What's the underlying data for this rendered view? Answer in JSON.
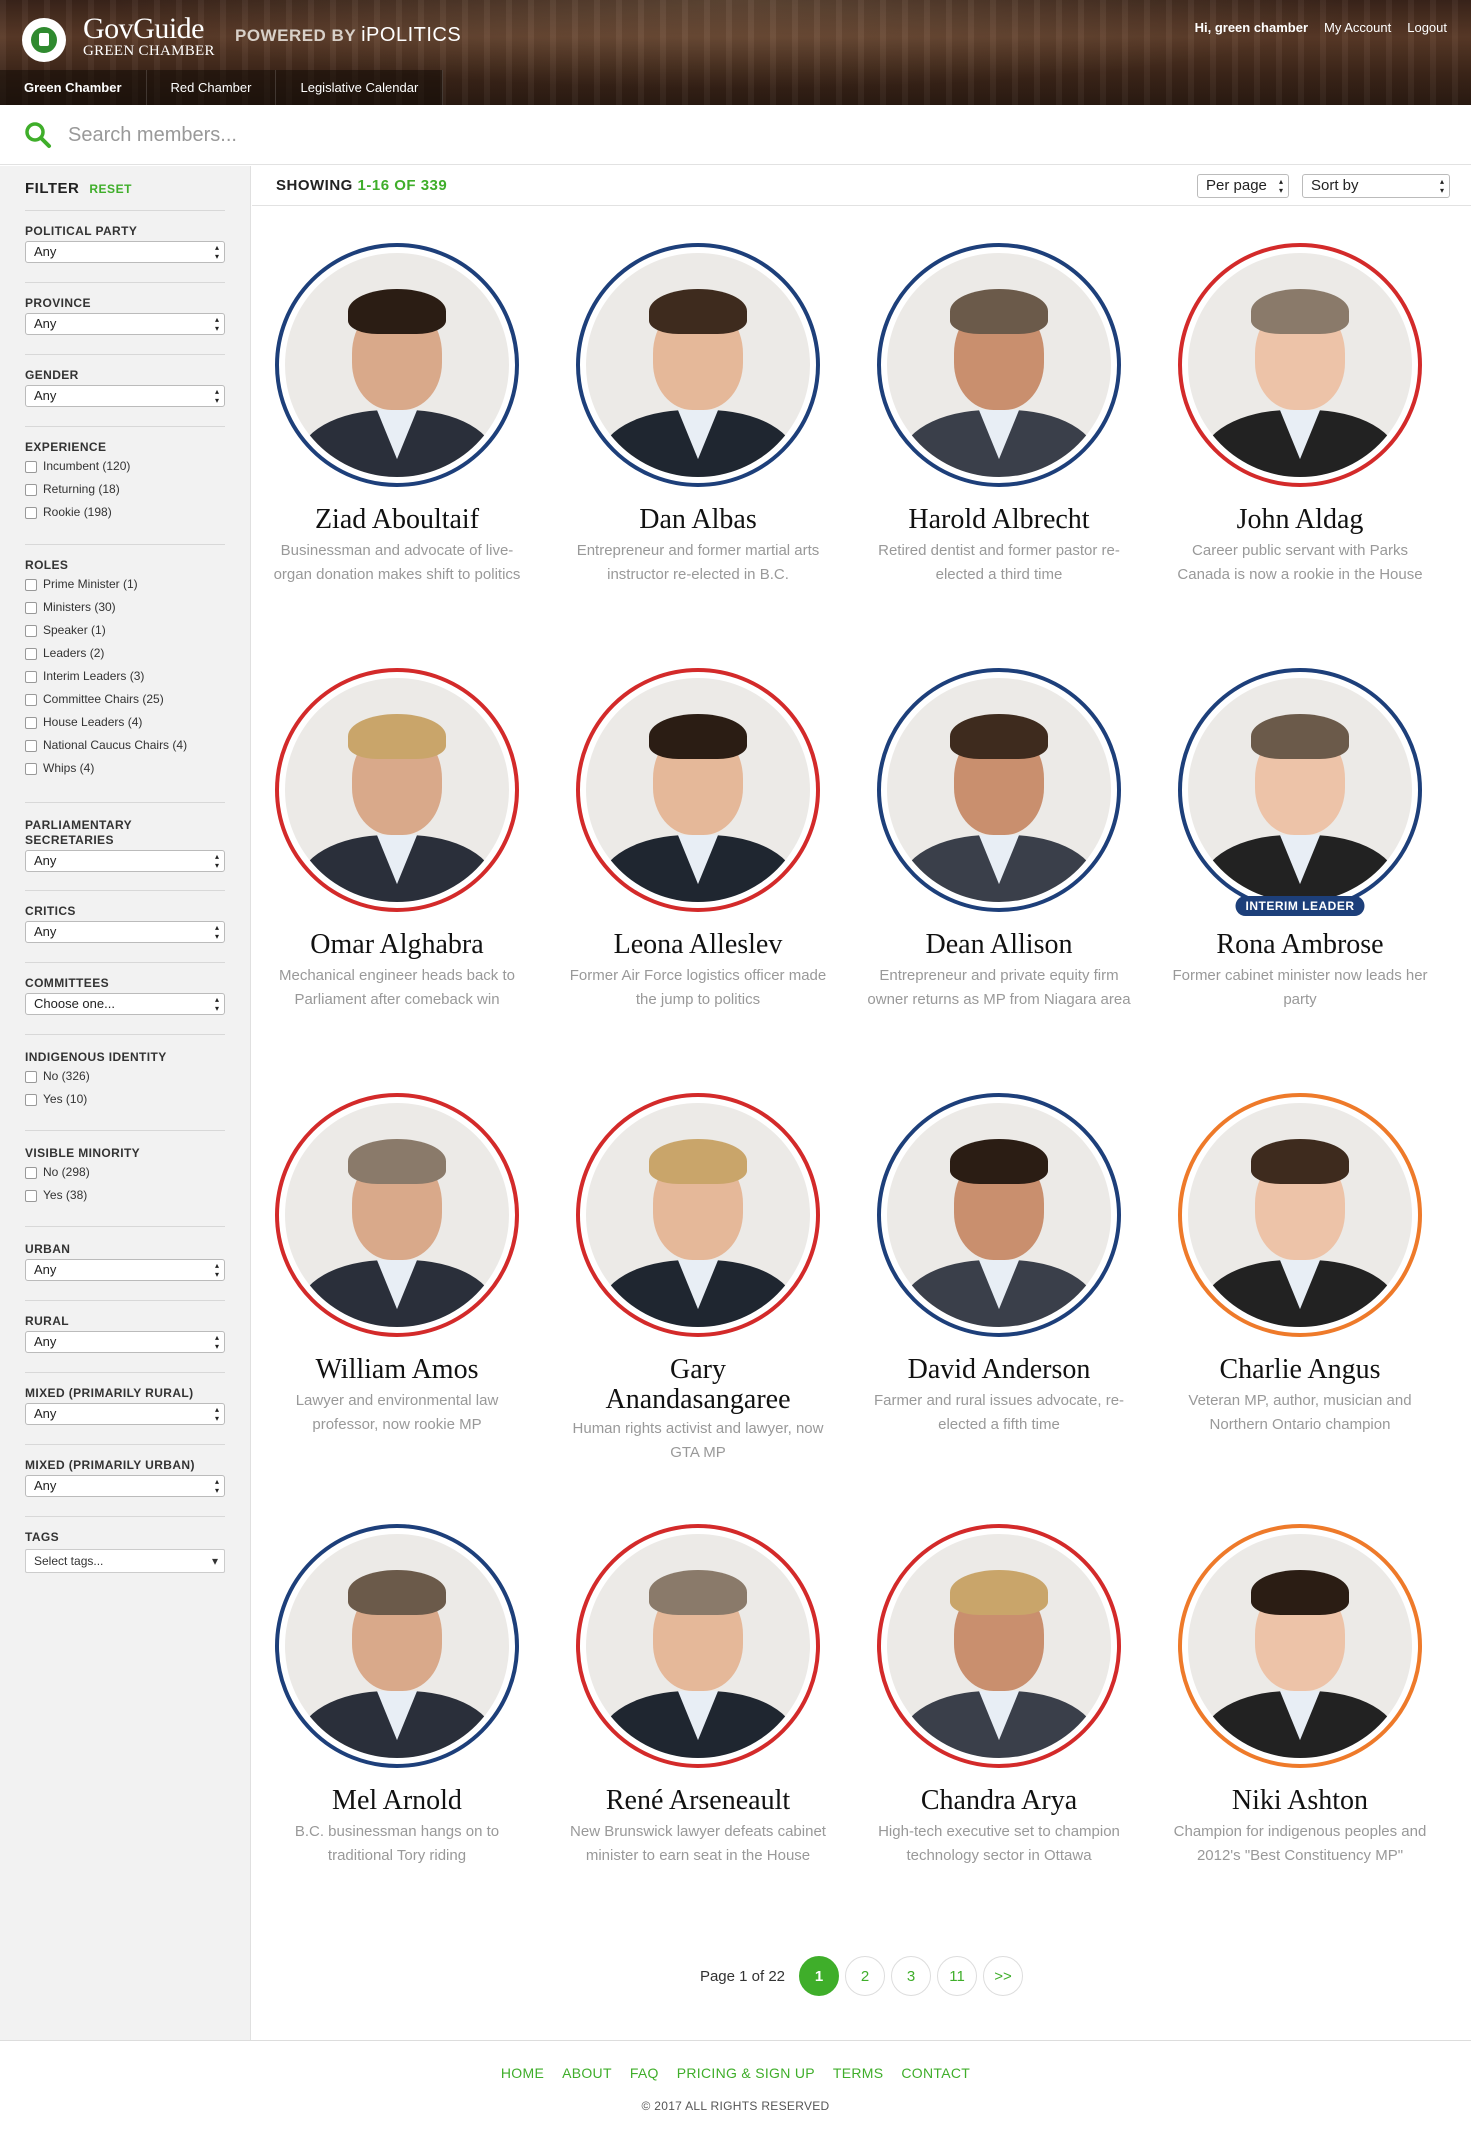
{
  "header": {
    "brand_name": "GovGuide",
    "brand_sub": "GREEN CHAMBER",
    "powered_by": "POWERED BY",
    "powered_brand": "iPOLITICS",
    "greeting": "Hi, green chamber",
    "my_account": "My Account",
    "logout": "Logout",
    "tabs": [
      "Green Chamber",
      "Red Chamber",
      "Legislative Calendar"
    ]
  },
  "search": {
    "placeholder": "Search members..."
  },
  "filter": {
    "title": "FILTER",
    "reset": "RESET",
    "political_party": {
      "title": "POLITICAL PARTY",
      "value": "Any"
    },
    "province": {
      "title": "PROVINCE",
      "value": "Any"
    },
    "gender": {
      "title": "GENDER",
      "value": "Any"
    },
    "experience": {
      "title": "EXPERIENCE",
      "options": [
        "Incumbent (120)",
        "Returning (18)",
        "Rookie (198)"
      ]
    },
    "roles": {
      "title": "ROLES",
      "options": [
        "Prime Minister (1)",
        "Ministers (30)",
        "Speaker (1)",
        "Leaders (2)",
        "Interim Leaders (3)",
        "Committee Chairs (25)",
        "House Leaders (4)",
        "National Caucus Chairs (4)",
        "Whips (4)"
      ]
    },
    "parliamentary_secretaries": {
      "title_line1": "PARLIAMENTARY",
      "title_line2": "SECRETARIES",
      "value": "Any"
    },
    "critics": {
      "title": "CRITICS",
      "value": "Any"
    },
    "committees": {
      "title": "COMMITTEES",
      "value": "Choose one..."
    },
    "indigenous": {
      "title": "INDIGENOUS IDENTITY",
      "options": [
        "No (326)",
        "Yes (10)"
      ]
    },
    "visible_minority": {
      "title": "VISIBLE MINORITY",
      "options": [
        "No (298)",
        "Yes (38)"
      ]
    },
    "urban": {
      "title": "URBAN",
      "value": "Any"
    },
    "rural": {
      "title": "RURAL",
      "value": "Any"
    },
    "mixed_rural": {
      "title": "MIXED (PRIMARILY RURAL)",
      "value": "Any"
    },
    "mixed_urban": {
      "title": "MIXED (PRIMARILY URBAN)",
      "value": "Any"
    },
    "tags": {
      "title": "TAGS",
      "placeholder": "Select tags..."
    }
  },
  "results": {
    "showing_label": "SHOWING",
    "range": "1-16 OF 339",
    "per_page": "Per page",
    "sort_by": "Sort by"
  },
  "members": [
    {
      "name": "Ziad Aboultaif",
      "desc": "Businessman and advocate of live-organ donation makes shift to politics",
      "party_color": "blue"
    },
    {
      "name": "Dan Albas",
      "desc": "Entrepreneur and former martial arts instructor re-elected in B.C.",
      "party_color": "blue"
    },
    {
      "name": "Harold Albrecht",
      "desc": "Retired dentist and former pastor re-elected a third time",
      "party_color": "blue"
    },
    {
      "name": "John Aldag",
      "desc": "Career public servant with Parks Canada is now a rookie in the House",
      "party_color": "red"
    },
    {
      "name": "Omar Alghabra",
      "desc": "Mechanical engineer heads back to Parliament after comeback win",
      "party_color": "red"
    },
    {
      "name": "Leona Alleslev",
      "desc": "Former Air Force logistics officer made the jump to politics",
      "party_color": "red"
    },
    {
      "name": "Dean Allison",
      "desc": "Entrepreneur and private equity firm owner returns as MP from Niagara area",
      "party_color": "blue"
    },
    {
      "name": "Rona Ambrose",
      "desc": "Former cabinet minister now leads her party",
      "party_color": "blue",
      "badge": "INTERIM LEADER"
    },
    {
      "name": "William Amos",
      "desc": "Lawyer and environmental law professor, now rookie MP",
      "party_color": "red"
    },
    {
      "name": "Gary Anandasangaree",
      "desc": "Human rights activist and lawyer, now GTA MP",
      "party_color": "red"
    },
    {
      "name": "David Anderson",
      "desc": "Farmer and rural issues advocate, re-elected a fifth time",
      "party_color": "blue"
    },
    {
      "name": "Charlie Angus",
      "desc": "Veteran MP, author, musician and Northern Ontario champion",
      "party_color": "orange"
    },
    {
      "name": "Mel Arnold",
      "desc": "B.C. businessman hangs on to traditional Tory riding",
      "party_color": "blue"
    },
    {
      "name": "René Arseneault",
      "desc": "New Brunswick lawyer defeats cabinet minister to earn seat in the House",
      "party_color": "red"
    },
    {
      "name": "Chandra Arya",
      "desc": "High-tech executive set to champion technology sector in Ottawa",
      "party_color": "red"
    },
    {
      "name": "Niki Ashton",
      "desc": "Champion for indigenous peoples and 2012's \"Best Constituency MP\"",
      "party_color": "orange"
    }
  ],
  "pagination": {
    "label": "Page 1 of 22",
    "pages": [
      "1",
      "2",
      "3",
      "11",
      ">>"
    ]
  },
  "footer": {
    "links": [
      "HOME",
      "ABOUT",
      "FAQ",
      "PRICING & SIGN UP",
      "TERMS",
      "CONTACT"
    ],
    "copyright": "© 2017 ALL RIGHTS RESERVED"
  },
  "colors": {
    "accent": "#3fae2a",
    "conservative": "#1d3f7a",
    "liberal": "#d32a2a",
    "ndp": "#ee7a2a"
  }
}
